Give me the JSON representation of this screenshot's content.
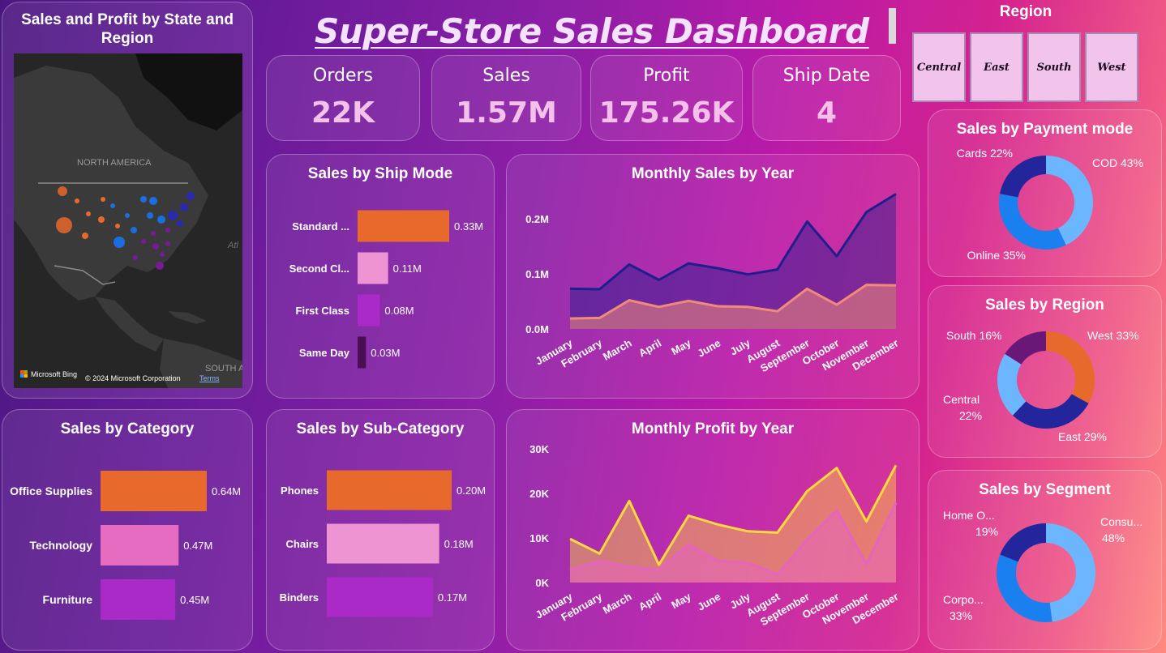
{
  "dashboard_title": "Super-Store Sales Dashboard",
  "kpis": [
    {
      "label": "Orders",
      "value": "22K"
    },
    {
      "label": "Sales",
      "value": "1.57M"
    },
    {
      "label": "Profit",
      "value": "175.26K"
    },
    {
      "label": "Ship Date",
      "value": "4"
    }
  ],
  "region_slicer": {
    "title": "Region",
    "options": [
      "Central",
      "East",
      "South",
      "West"
    ]
  },
  "map_card": {
    "title": "Sales and Profit by State and Region",
    "label_north_america": "NORTH AMERICA",
    "label_south": "SOUTH A",
    "label_atl": "Atl",
    "bing": "Microsoft Bing",
    "copyright": "© 2024 Microsoft Corporation",
    "terms": "Terms"
  },
  "colors": {
    "orange": "#e8692c",
    "pink": "#e79bd6",
    "hotpink": "#e66cc2",
    "purple": "#a92ac6",
    "darkpurple": "#4a0f52",
    "navy": "#22259b",
    "blue": "#1a80f0",
    "lightblue": "#6cb6ff",
    "gold": "#ffd93d",
    "region_central": "#6cb6ff",
    "region_east": "#22259b",
    "region_south": "#6a1878",
    "region_west": "#e8692c"
  },
  "chart_data": [
    {
      "id": "ship_mode",
      "type": "bar",
      "orientation": "horizontal",
      "title": "Sales by Ship Mode",
      "categories": [
        "Standard ...",
        "Second Cl...",
        "First Class",
        "Same Day"
      ],
      "values": [
        0.33,
        0.11,
        0.08,
        0.03
      ],
      "labels": [
        "0.33M",
        "0.11M",
        "0.08M",
        "0.03M"
      ],
      "colors": [
        "#e8692c",
        "#ef94d2",
        "#a92ac6",
        "#4a0f52"
      ],
      "max": 0.33
    },
    {
      "id": "monthly_sales",
      "type": "area",
      "title": "Monthly Sales by Year",
      "x": [
        "January",
        "February",
        "March",
        "April",
        "May",
        "June",
        "July",
        "August",
        "September",
        "October",
        "November",
        "December"
      ],
      "series": [
        {
          "values": [
            0.073,
            0.072,
            0.117,
            0.089,
            0.119,
            0.11,
            0.099,
            0.108,
            0.195,
            0.132,
            0.212,
            0.245
          ],
          "color": "#1f1e8c"
        },
        {
          "values": [
            0.019,
            0.02,
            0.052,
            0.04,
            0.051,
            0.041,
            0.04,
            0.032,
            0.073,
            0.044,
            0.08,
            0.079
          ],
          "color": "#f08a7a"
        }
      ],
      "yticks": [
        "0.0M",
        "0.1M",
        "0.2M"
      ],
      "ytick_values": [
        0,
        0.1,
        0.2
      ],
      "ylim": [
        0,
        0.25
      ]
    },
    {
      "id": "payment_mode",
      "type": "pie",
      "donut": true,
      "title": "Sales by Payment mode",
      "slices": [
        {
          "label": "COD 43%",
          "value": 43,
          "color": "#6cb6ff"
        },
        {
          "label": "Online 35%",
          "value": 35,
          "color": "#1a80f0"
        },
        {
          "label": "Cards 22%",
          "value": 22,
          "color": "#22259b"
        }
      ]
    },
    {
      "id": "region",
      "type": "pie",
      "donut": true,
      "title": "Sales by Region",
      "slices": [
        {
          "label": "West 33%",
          "value": 33,
          "color": "#e8692c"
        },
        {
          "label": "East 29%",
          "value": 29,
          "color": "#22259b"
        },
        {
          "label": "Central 22%",
          "value": 22,
          "color": "#6cb6ff"
        },
        {
          "label": "South 16%",
          "value": 16,
          "color": "#6a1878"
        }
      ]
    },
    {
      "id": "category",
      "type": "bar",
      "orientation": "horizontal",
      "title": "Sales by Category",
      "categories": [
        "Office Supplies",
        "Technology",
        "Furniture"
      ],
      "values": [
        0.64,
        0.47,
        0.45
      ],
      "labels": [
        "0.64M",
        "0.47M",
        "0.45M"
      ],
      "colors": [
        "#e8692c",
        "#e66cc2",
        "#a92ac6"
      ],
      "max": 0.64
    },
    {
      "id": "sub_category",
      "type": "bar",
      "orientation": "horizontal",
      "title": "Sales by Sub-Category",
      "categories": [
        "Phones",
        "Chairs",
        "Binders"
      ],
      "values": [
        0.2,
        0.18,
        0.17
      ],
      "labels": [
        "0.20M",
        "0.18M",
        "0.17M"
      ],
      "colors": [
        "#e8692c",
        "#ef94d2",
        "#a92ac6"
      ],
      "max": 0.2
    },
    {
      "id": "monthly_profit",
      "type": "area",
      "title": "Monthly Profit by Year",
      "x": [
        "January",
        "February",
        "March",
        "April",
        "May",
        "June",
        "July",
        "August",
        "September",
        "October",
        "November",
        "December"
      ],
      "series": [
        {
          "values": [
            9800,
            6500,
            18300,
            4000,
            15000,
            13000,
            11500,
            11200,
            20500,
            25700,
            13700,
            26300
          ],
          "color": "#ffd93d"
        },
        {
          "values": [
            2800,
            4800,
            3500,
            2800,
            8500,
            4800,
            4400,
            1800,
            9600,
            16200,
            4100,
            17900
          ],
          "color": "#e664c0"
        }
      ],
      "yticks": [
        "0K",
        "10K",
        "20K",
        "30K"
      ],
      "ytick_values": [
        0,
        10000,
        20000,
        30000
      ],
      "ylim": [
        0,
        30000
      ]
    },
    {
      "id": "segment",
      "type": "pie",
      "donut": true,
      "title": "Sales by Segment",
      "slices": [
        {
          "label": "Consu... 48%",
          "value": 48,
          "color": "#6cb6ff"
        },
        {
          "label": "Corpo... 33%",
          "value": 33,
          "color": "#1a80f0"
        },
        {
          "label": "Home O... 19%",
          "value": 19,
          "color": "#22259b"
        }
      ]
    }
  ]
}
